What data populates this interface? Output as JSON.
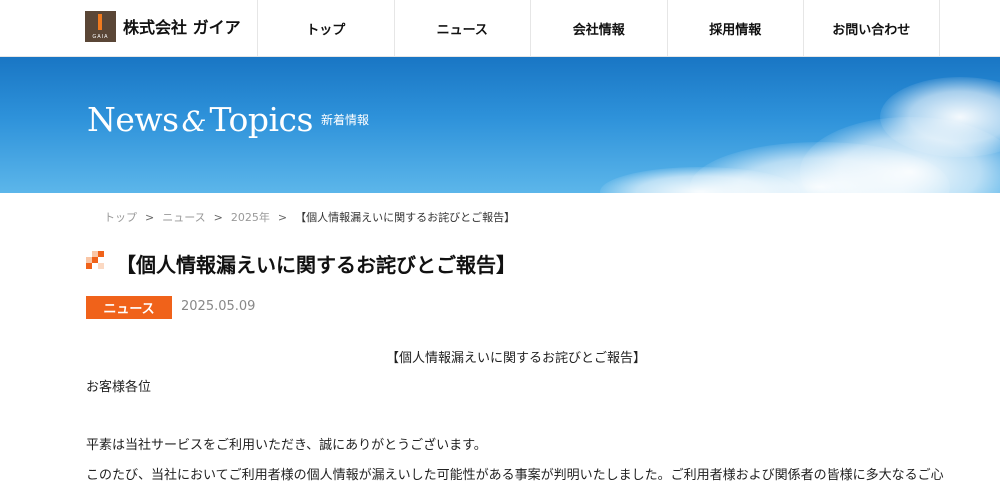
{
  "header": {
    "logo_text": "GAIA",
    "company_name": "株式会社 ガイア",
    "nav": [
      "トップ",
      "ニュース",
      "会社情報",
      "採用情報",
      "お問い合わせ"
    ]
  },
  "hero": {
    "title_news": "News",
    "title_amp": "&",
    "title_topics": "Topics",
    "subtitle": "新着情報"
  },
  "breadcrumb": {
    "items": [
      "トップ",
      "ニュース",
      "2025年"
    ],
    "separator": ">",
    "current": "【個人情報漏えいに関するお詫びとご報告】"
  },
  "article": {
    "title": "【個人情報漏えいに関するお詫びとご報告】",
    "category": "ニュース",
    "date": "2025.05.09",
    "heading_center": "【個人情報漏えいに関するお詫びとご報告】",
    "salutation": "お客様各位",
    "para1": "平素は当社サービスをご利用いただき、誠にありがとうございます。",
    "para2": "このたび、当社においてご利用者様の個人情報が漏えいした可能性がある事案が判明いたしました。ご利用者様および関係者の皆様に多大なるご心"
  },
  "colors": {
    "accent": "#f0621a",
    "brand_brown": "#5a4636",
    "sky_top": "#1976c4",
    "sky_bottom": "#5cb6ea"
  }
}
